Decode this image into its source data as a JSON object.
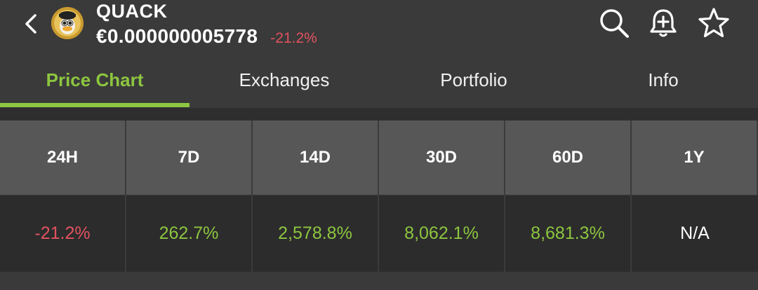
{
  "header": {
    "title": "QUACK",
    "price": "€0.000000005778",
    "change": "-21.2%",
    "change_color": "#e0525f",
    "icons": [
      "chevron-left-icon",
      "search-icon",
      "bell-plus-icon",
      "star-icon"
    ]
  },
  "tabs": [
    {
      "label": "Price Chart",
      "active": true
    },
    {
      "label": "Exchanges",
      "active": false
    },
    {
      "label": "Portfolio",
      "active": false
    },
    {
      "label": "Info",
      "active": false
    }
  ],
  "accent_color": "#8dc63f",
  "performance": {
    "headers": [
      "24H",
      "7D",
      "14D",
      "30D",
      "60D",
      "1Y"
    ],
    "values": [
      "-21.2%",
      "262.7%",
      "2,578.8%",
      "8,062.1%",
      "8,681.3%",
      "N/A"
    ],
    "colors": [
      "#e0525f",
      "#8dc63f",
      "#8dc63f",
      "#8dc63f",
      "#8dc63f",
      "#ffffff"
    ]
  }
}
